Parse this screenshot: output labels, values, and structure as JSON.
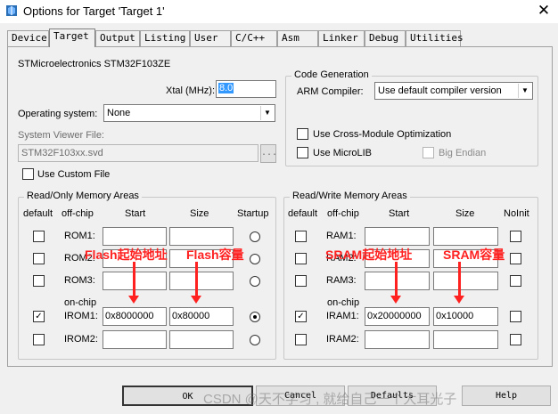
{
  "window": {
    "title": "Options for Target 'Target 1'",
    "close_glyph": "✕"
  },
  "tabs": [
    {
      "label": "Device"
    },
    {
      "label": "Target"
    },
    {
      "label": "Output"
    },
    {
      "label": "Listing"
    },
    {
      "label": "User"
    },
    {
      "label": "C/C++"
    },
    {
      "label": "Asm"
    },
    {
      "label": "Linker"
    },
    {
      "label": "Debug"
    },
    {
      "label": "Utilities"
    }
  ],
  "device_name": "STMicroelectronics STM32F103ZE",
  "xtal": {
    "label": "Xtal (MHz):",
    "value": "8.0"
  },
  "operating_system": {
    "label": "Operating system:",
    "value": "None"
  },
  "system_viewer": {
    "label": "System Viewer File:",
    "value": "STM32F103xx.svd",
    "browse": "..."
  },
  "use_custom_file": {
    "label": "Use Custom File",
    "checked": false
  },
  "code_generation": {
    "legend": "Code Generation",
    "arm_compiler_label": "ARM Compiler:",
    "arm_compiler_value": "Use default compiler version",
    "cross_module_label": "Use Cross-Module Optimization",
    "microlib_label": "Use MicroLIB",
    "big_endian_label": "Big Endian"
  },
  "rom_group": {
    "legend": "Read/Only Memory Areas",
    "headers": {
      "default": "default",
      "offchip": "off-chip",
      "start": "Start",
      "size": "Size",
      "startup": "Startup"
    },
    "onchip_label": "on-chip",
    "rows": [
      {
        "name": "ROM1:",
        "start": "",
        "size": "",
        "default": false,
        "startup": false
      },
      {
        "name": "ROM2:",
        "start": "",
        "size": "",
        "default": false,
        "startup": false
      },
      {
        "name": "ROM3:",
        "start": "",
        "size": "",
        "default": false,
        "startup": false
      },
      {
        "name": "IROM1:",
        "start": "0x8000000",
        "size": "0x80000",
        "default": true,
        "startup": true
      },
      {
        "name": "IROM2:",
        "start": "",
        "size": "",
        "default": false,
        "startup": false
      }
    ]
  },
  "ram_group": {
    "legend": "Read/Write Memory Areas",
    "headers": {
      "default": "default",
      "offchip": "off-chip",
      "start": "Start",
      "size": "Size",
      "noinit": "NoInit"
    },
    "onchip_label": "on-chip",
    "rows": [
      {
        "name": "RAM1:",
        "start": "",
        "size": "",
        "default": false,
        "noinit": false
      },
      {
        "name": "RAM2:",
        "start": "",
        "size": "",
        "default": false,
        "noinit": false
      },
      {
        "name": "RAM3:",
        "start": "",
        "size": "",
        "default": false,
        "noinit": false
      },
      {
        "name": "IRAM1:",
        "start": "0x20000000",
        "size": "0x10000",
        "default": true,
        "noinit": false
      },
      {
        "name": "IRAM2:",
        "start": "",
        "size": "",
        "default": false,
        "noinit": false
      }
    ]
  },
  "annotations": {
    "flash_start": "Flash起始地址",
    "flash_size": "Flash容量",
    "sram_start": "SRAM起始地址",
    "sram_size": "SRAM容量",
    "color": "#ff2020"
  },
  "buttons": {
    "ok": "OK",
    "cancel": "Cancel",
    "defaults": "Defaults",
    "help": "Help"
  },
  "watermark": "CSDN @天不学习 , 就给自己一个大耳光子",
  "check_glyph": "✓"
}
